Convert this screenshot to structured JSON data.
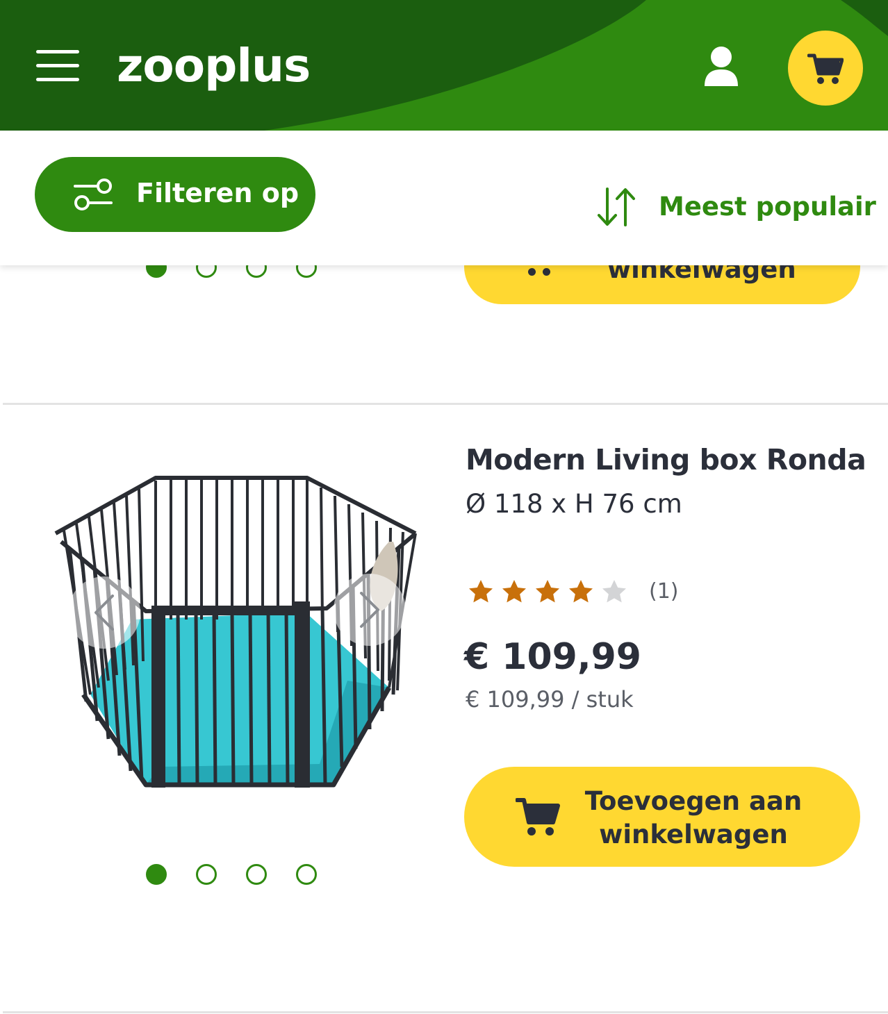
{
  "header": {
    "logo": "zooplus",
    "menu_icon": "hamburger-menu-icon",
    "account_icon": "user-icon",
    "cart_icon": "shopping-cart-icon",
    "colors": {
      "dark_green": "#1b5e0f",
      "green": "#2f8a10",
      "yellow": "#ffd831"
    }
  },
  "toolbar": {
    "filter_label": "Filteren op",
    "filter_icon": "sliders-icon",
    "sort_label": "Meest populair",
    "sort_icon": "sort-arrows-icon"
  },
  "previous_product": {
    "image_dots": {
      "count": 4,
      "active": 0
    },
    "add_to_cart_visible_text": "winkelwagen"
  },
  "product": {
    "title": "Modern Living box Ronda",
    "variant": "Ø 118 x H 76 cm",
    "rating": {
      "value": 4,
      "max": 5,
      "count_label": "(1)"
    },
    "price": "€ 109,99",
    "unit_price": "€ 109,99 / stuk",
    "add_to_cart_line1": "Toevoegen aan",
    "add_to_cart_line2": "winkelwagen",
    "image_dots": {
      "count": 4,
      "active": 0
    },
    "prev_icon": "chevron-left-icon",
    "next_icon": "chevron-right-icon"
  }
}
